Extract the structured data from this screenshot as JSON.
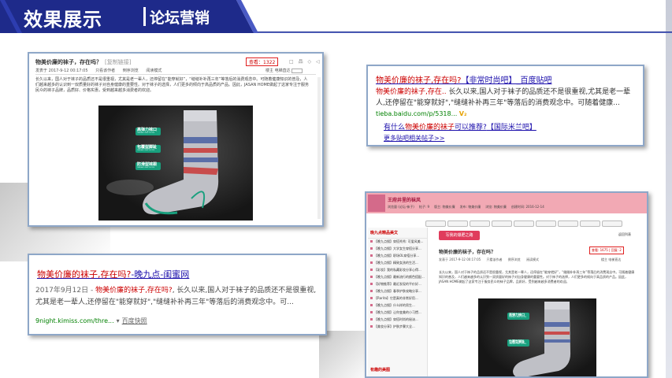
{
  "header": {
    "title": "效果展示",
    "subtitle": "论坛营销"
  },
  "forum_article": {
    "title": "物美价廉的袜子，存在吗？",
    "tag": "[复制链接]",
    "views": "查看：1322",
    "tools": "□ 品 ◇ ◁",
    "meta": [
      "发表于 2017-9-12 00:17:05",
      "只看该作者",
      "倒序浏览",
      "阅读模式"
    ],
    "meta_right": [
      "楼主",
      "电梯直达"
    ],
    "body": "长久以来，国人对于袜子的品质还不是很重视，尤其是老一辈人，还停留在“能穿就好”，“缝缝补补再三年”等落后的消费观念中。可随着健康知识的普及，人们越来越多的认识到一双质量好的袜子对自身健康的重要性。对于袜子的选择，人们更多的倾向于高品质的产品。因此，JASAN HOME做起了这家专注于服务民众的袜子品牌，品质好、价格实惠，受到越来越多消费者的欢迎。",
    "sock_labels": [
      {
        "title": "高弹力袜口",
        "caption": "CASUAL LIGHT SOCKS"
      },
      {
        "title": "包覆型脚趾",
        "caption": "CASUAL LIGHT SOCKS"
      },
      {
        "title": "防滑型袜跟",
        "caption": "CASUAL LIGHT SOCKS"
      }
    ]
  },
  "baidu_result": {
    "title_highlight": "物美价廉的袜子,存在吗?",
    "title_rest": "【非常时尚吧】_百度贴吧",
    "desc_highlight": "物美价廉的袜子,存在..",
    "desc_rest": " 长久以来,国人对于袜子的品质还不是很重视,尤其是老一辈人,还停留在\"能穿就好\",\"缝缝补补再三年\"等落后的消费观念中。可随着健康...",
    "url": "tieba.baidu.com/p/5318...",
    "v_badge": "V₂",
    "sub_pre": "有什么",
    "sub_highlight": "物美价廉的袜子",
    "sub_mid": "可以推荐?",
    "sub_rest": "【国际米兰吧】",
    "more": "更多贴吧相关帖子>>"
  },
  "night_result": {
    "title_highlight": "物美价廉的袜子,存在吗?",
    "title_rest": "-晚九点-闺蜜网",
    "date": "2017年9月12日 - ",
    "desc_highlight": "物美价廉的袜子,存在吗?",
    "desc_rest": ", 长久以来,国人对于袜子的品质还不是很重视,尤其是老一辈人,还停留在\"能穿就好\",\"缝缝补补再三年\"等落后的消费观念中。可...",
    "url": "9night.kimiss.com/thre...",
    "dropdown": "▾",
    "snapshot": "百度快照"
  },
  "forum_page": {
    "board_name": "王府井里的袜风",
    "board_info": [
      "浏览量 (论坛-袜子)",
      "帖子: 9",
      "版主: 物美价廉",
      "发布: 物美价廉",
      "浏览: 物美价廉",
      "创建时间: 2016-12-14"
    ],
    "hot_list_title": "晚九点精品美文",
    "hot_items": [
      "【晚九点搜】穿搭秀秀: 可爱风美...",
      "【晚九点搜】大学女生穿搭分享...",
      "【晚九点搜】职场OL穿搭分享...",
      "【晚九点搜】精致女孩的生活...",
      "【彩妆】我的私藏彩妆分享心得...",
      "【晚九点搜】最新流行的颜色搭配...",
      "【好物推荐】最近发现的平价好...",
      "【晚九点搜】春季护肤攻略分享...",
      "【Rarita】它是真的非常好用...",
      "【晚九点搜】什么样的男生...",
      "【晚九点搜】让你变美的小习惯...",
      "【晚九点搜】穿搭时尚的秘诀...",
      "【美妆分享】护肤步骤大全..."
    ],
    "list_footer": "有趣的美图",
    "post_button": "写我的爆肥之路",
    "back_link": "返回列表",
    "post_title": "物美价廉的袜子，存在吗？",
    "views": "查看: 1675 | 回复: 2",
    "meta": [
      "发表于 2017-9-12 00:17:05",
      "只看该作者",
      "倒序浏览",
      "阅读模式"
    ],
    "meta_right": [
      "楼主",
      "电梯直达"
    ],
    "body": "长久以来，国人对于袜子的品质还不是很重视，尤其是老一辈人，还停留在“能穿就好”，“缝缝补补再三年”等落后的消费观念中。可随着健康知识的普及，人们越来越多的认识到一双质量好的袜子对自身健康的重要性。对于袜子的选择，人们更多的倾向于高品质的产品。因此，JASAN HOME做起了这家专注于服务民众的袜子品牌，品质好，受到越来越多消费者的欢迎。",
    "sock_labels": [
      {
        "title": "高弹力袜口",
        "caption": "CASUAL LIGHT SOCKS"
      },
      {
        "title": "包覆型脚趾",
        "caption": "CASUAL LIGHT SOCKS"
      }
    ]
  },
  "colors": {
    "banner": "#1e2a8a",
    "link": "#1a0dab",
    "highlight": "#cc0000",
    "url": "#008000",
    "label_green": "#19a07e"
  }
}
